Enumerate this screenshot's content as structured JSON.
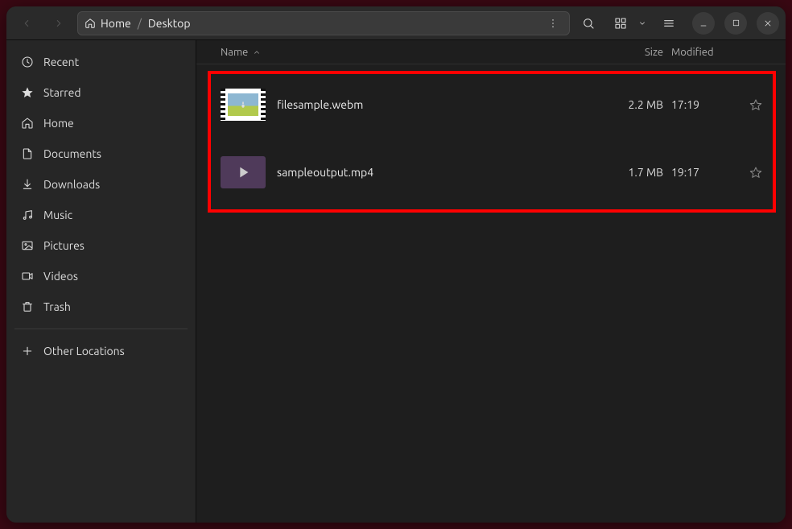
{
  "breadcrumb": [
    {
      "label": "Home",
      "icon": "home"
    },
    {
      "label": "Desktop"
    }
  ],
  "sidebar": {
    "items": [
      {
        "label": "Recent",
        "icon": "clock"
      },
      {
        "label": "Starred",
        "icon": "star-filled"
      },
      {
        "label": "Home",
        "icon": "home"
      },
      {
        "label": "Documents",
        "icon": "document"
      },
      {
        "label": "Downloads",
        "icon": "download"
      },
      {
        "label": "Music",
        "icon": "music"
      },
      {
        "label": "Pictures",
        "icon": "picture"
      },
      {
        "label": "Videos",
        "icon": "video"
      },
      {
        "label": "Trash",
        "icon": "trash"
      }
    ],
    "other": {
      "label": "Other Locations",
      "icon": "plus"
    }
  },
  "columns": {
    "name": "Name",
    "size": "Size",
    "modified": "Modified"
  },
  "files": [
    {
      "name": "filesample.webm",
      "size": "2.2 MB",
      "modified": "17:19",
      "thumb": "film"
    },
    {
      "name": "sampleoutput.mp4",
      "size": "1.7 MB",
      "modified": "19:17",
      "thumb": "play"
    }
  ]
}
